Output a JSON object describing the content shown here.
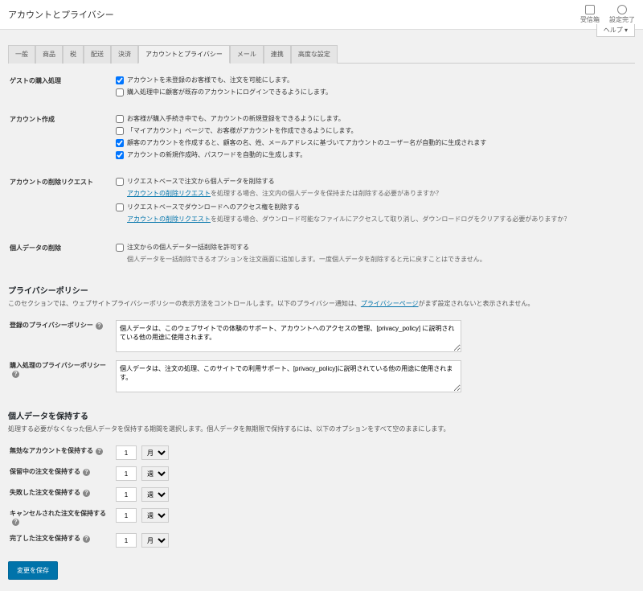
{
  "header": {
    "title": "アカウントとプライバシー",
    "inbox": "受信箱",
    "setup": "設定完了",
    "help": "ヘルプ ▾"
  },
  "tabs": [
    "一般",
    "商品",
    "税",
    "配送",
    "決済",
    "アカウントとプライバシー",
    "メール",
    "連携",
    "高度な設定"
  ],
  "active_tab": 5,
  "guest": {
    "label": "ゲストの購入処理",
    "c1": "アカウントを未登録のお客様でも、注文を可能にします。",
    "c2": "購入処理中に顧客が既存のアカウントにログインできるようにします。"
  },
  "account": {
    "label": "アカウント作成",
    "c1": "お客様が購入手続き中でも、アカウントの新規登録をできるようにします。",
    "c2": "「マイアカウント」ページで、お客様がアカウントを作成できるようにします。",
    "c3": "顧客のアカウントを作成すると、顧客の名、姓、メールアドレスに基づいてアカウントのユーザー名が自動的に生成されます",
    "c4": "アカウントの新規作成時、パスワードを自動的に生成します。"
  },
  "removal": {
    "label": "アカウントの削除リクエスト",
    "c1": "リクエストベースで注文から個人データを削除する",
    "c1_link": "アカウントの削除リクエスト",
    "c1_desc": "を処理する場合、注文内の個人データを保持または削除する必要がありますか？",
    "c2": "リクエストベースでダウンロードへのアクセス権を削除する",
    "c2_link": "アカウントの削除リクエスト",
    "c2_desc": "を処理する場合、ダウンロード可能なファイルにアクセスして取り消し、ダウンロードログをクリアする必要がありますか？"
  },
  "personal": {
    "label": "個人データの削除",
    "c1": "注文からの個人データ一括削除を許可する",
    "desc": "個人データを一括削除できるオプションを注文画面に追加します。一度個人データを削除すると元に戻すことはできません。"
  },
  "privacy": {
    "title": "プライバシーポリシー",
    "desc_pre": "このセクションでは、ウェブサイトプライバシーポリシーの表示方法をコントロールします。以下のプライバシー通知は、",
    "link": "プライバシーページ",
    "desc_post": "がまず設定されないと表示されません。",
    "reg_label": "登録のプライバシーポリシー",
    "reg_text": "個人データは、このウェブサイトでの体験のサポート、アカウントへのアクセスの管理、[privacy_policy] に説明されている他の用途に使用されます。",
    "chk_label": "購入処理のプライバシーポリシー",
    "chk_text": "個人データは、注文の処理、このサイトでの利用サポート、[privacy_policy]に説明されている他の用途に使用されます。"
  },
  "retain": {
    "title": "個人データを保持する",
    "desc": "処理する必要がなくなった個人データを保持する期間を選択します。個人データを無期限で保持するには、以下のオプションをすべて空のままにします。",
    "inactive": "無効なアカウントを保持する",
    "pending": "保留中の注文を保持する",
    "failed": "失敗した注文を保持する",
    "cancelled": "キャンセルされた注文を保持する",
    "completed": "完了した注文を保持する",
    "val": "1",
    "month": "月",
    "week": "週"
  },
  "save": "変更を保存"
}
